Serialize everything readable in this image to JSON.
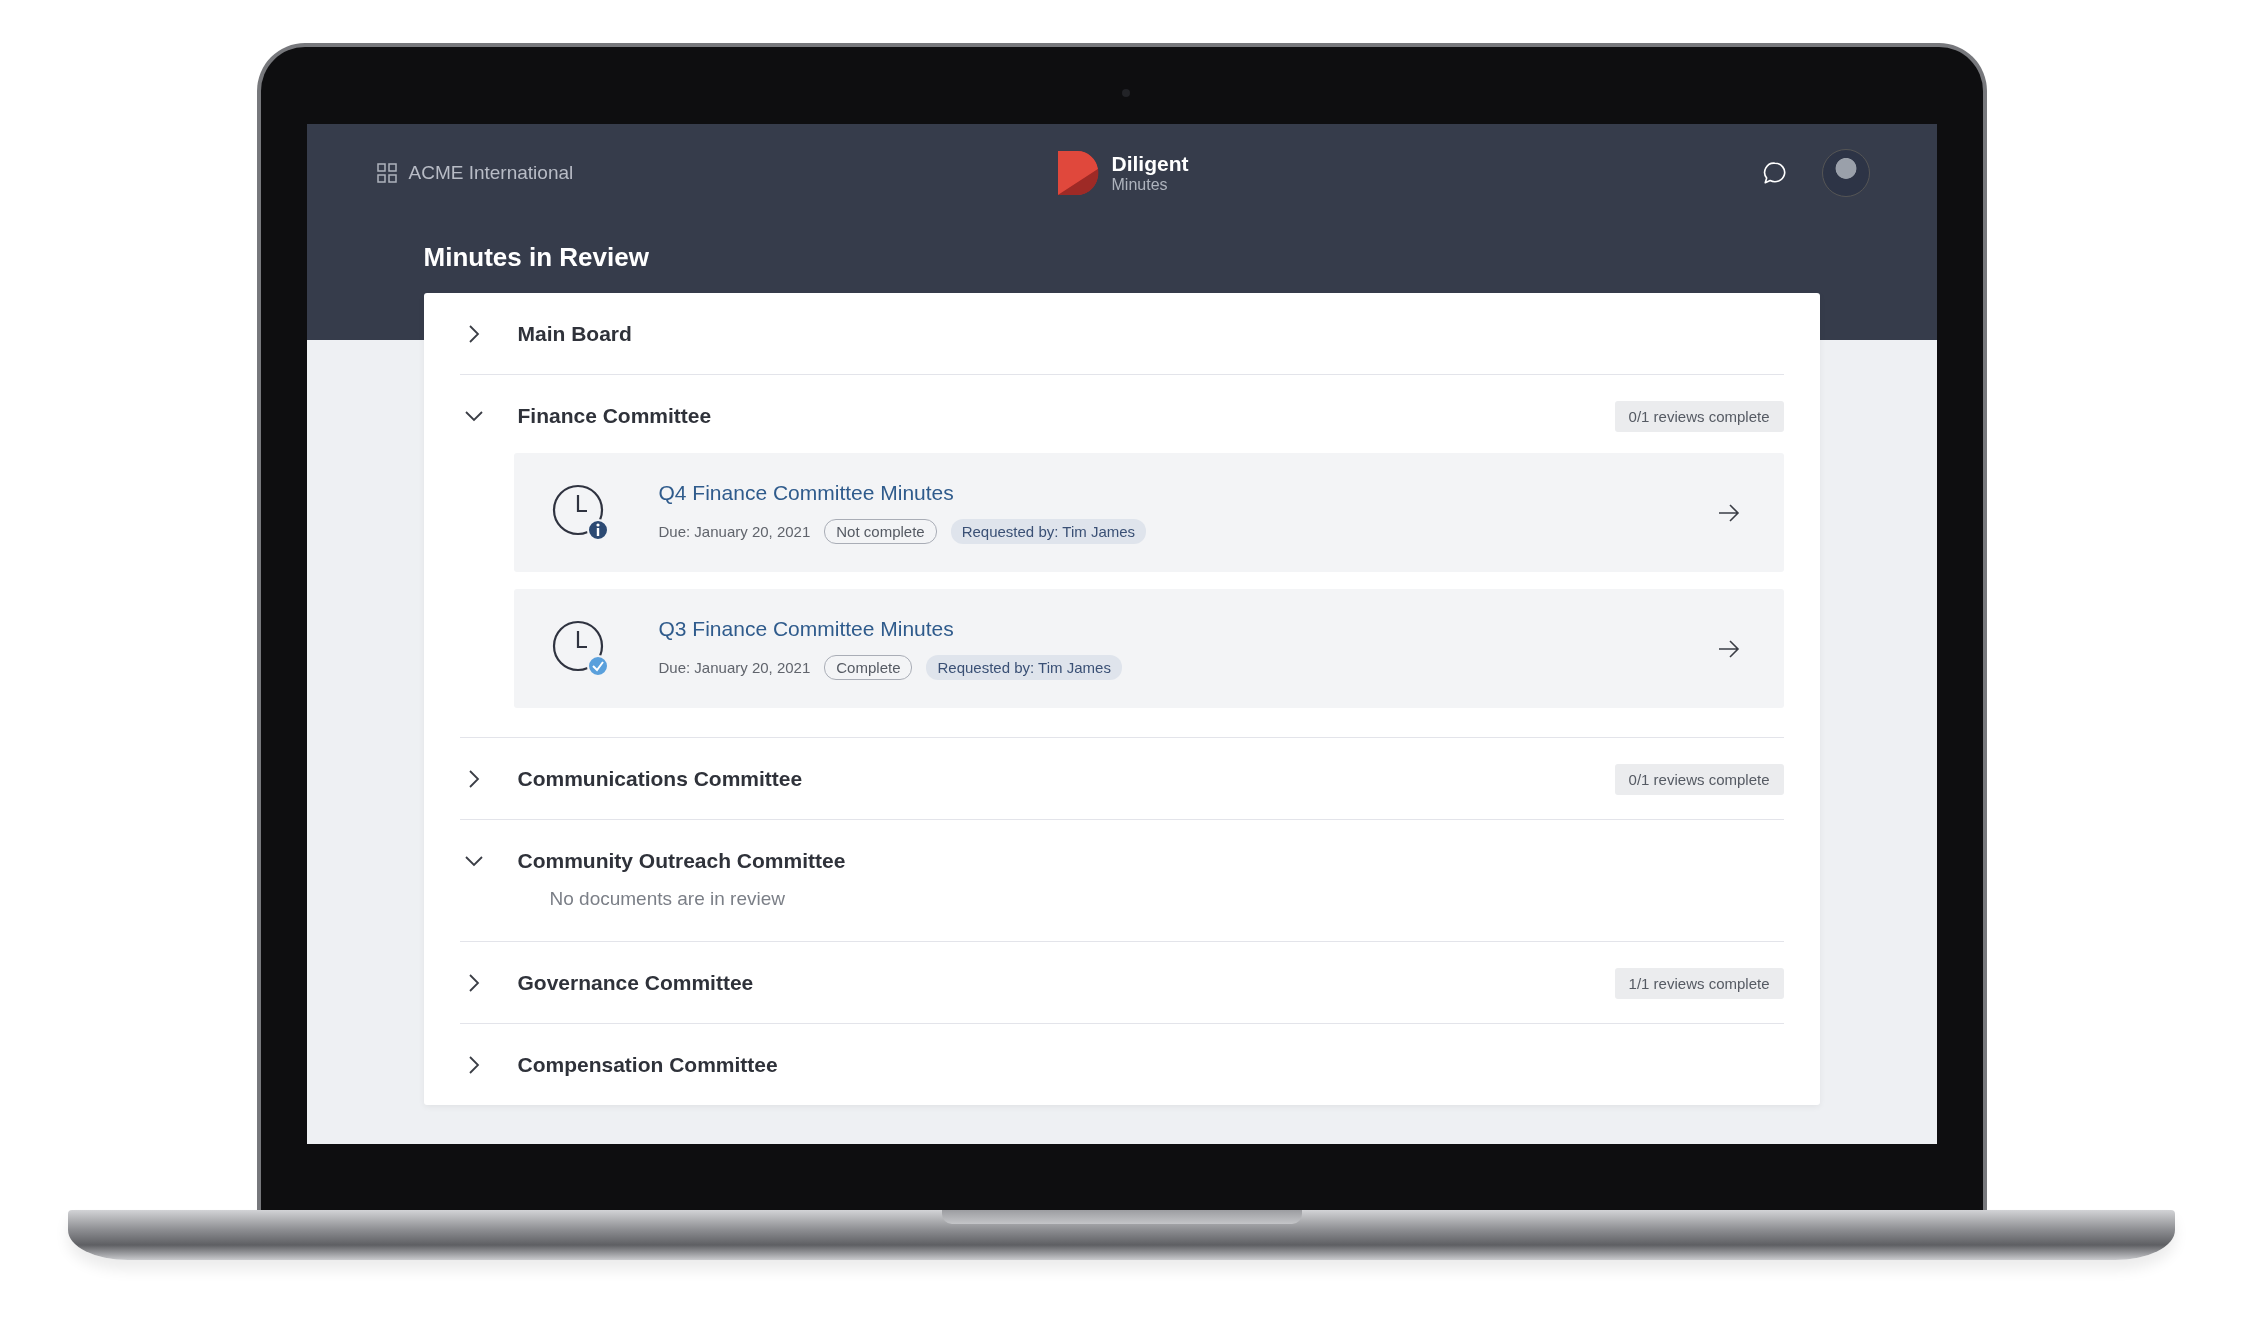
{
  "header": {
    "organization": "ACME International",
    "brand_name": "Diligent",
    "product": "Minutes"
  },
  "page_title": "Minutes in Review",
  "sections": [
    {
      "title": "Main Board",
      "expanded": false
    },
    {
      "title": "Finance Committee",
      "expanded": true,
      "badge": "0/1 reviews complete",
      "documents": [
        {
          "title": "Q4 Finance Committee Minutes",
          "due": "Due: January 20, 2021",
          "status": "Not complete",
          "complete": false,
          "requested_by": "Requested by: Tim James"
        },
        {
          "title": "Q3 Finance Committee Minutes",
          "due": "Due: January 20, 2021",
          "status": "Complete",
          "complete": true,
          "requested_by": "Requested by: Tim James"
        }
      ]
    },
    {
      "title": "Communications Committee",
      "expanded": false,
      "badge": "0/1 reviews complete"
    },
    {
      "title": "Community Outreach Committee",
      "expanded": true,
      "empty_message": "No documents are in review"
    },
    {
      "title": "Governance Committee",
      "expanded": false,
      "badge": "1/1 reviews complete"
    },
    {
      "title": "Compensation Committee",
      "expanded": false
    }
  ]
}
